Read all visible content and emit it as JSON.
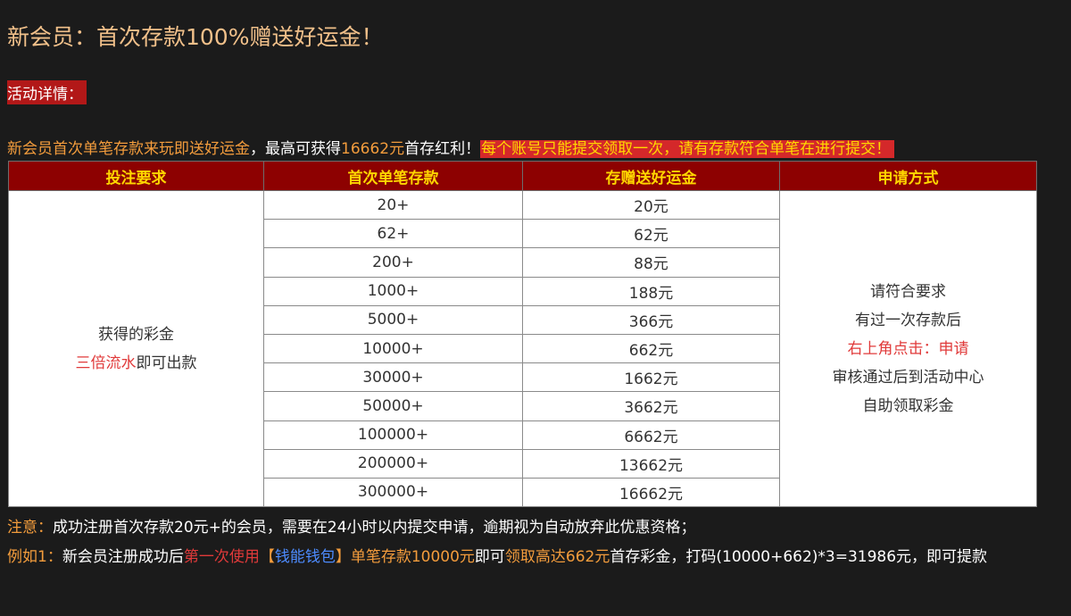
{
  "title": "新会员：首次存款100%赠送好运金！",
  "details_label": "活动详情：",
  "intro": {
    "part1": "新会员首次单笔存款来玩即送好运金",
    "part2": "，最高可获得",
    "amount": "16662元",
    "part3": "首存红利！",
    "warning": "每个账号只能提交领取一次，请有存款符合单笔在进行提交！"
  },
  "table": {
    "headers": [
      "投注要求",
      "首次单笔存款",
      "存赠送好运金",
      "申请方式"
    ],
    "requirement": {
      "line1": "获得的彩金",
      "highlight": "三倍流水",
      "line2_rest": "即可出款"
    },
    "rows": [
      {
        "deposit": "20+",
        "bonus": "20元"
      },
      {
        "deposit": "62+",
        "bonus": "62元"
      },
      {
        "deposit": "200+",
        "bonus": "88元"
      },
      {
        "deposit": "1000+",
        "bonus": "188元"
      },
      {
        "deposit": "5000+",
        "bonus": "366元"
      },
      {
        "deposit": "10000+",
        "bonus": "662元"
      },
      {
        "deposit": "30000+",
        "bonus": "1662元"
      },
      {
        "deposit": "50000+",
        "bonus": "3662元"
      },
      {
        "deposit": "100000+",
        "bonus": "6662元"
      },
      {
        "deposit": "200000+",
        "bonus": "13662元"
      },
      {
        "deposit": "300000+",
        "bonus": "16662元"
      }
    ],
    "apply": {
      "line1": "请符合要求",
      "line2": "有过一次存款后",
      "line3": "右上角点击：申请",
      "line4": "审核通过后到活动中心",
      "line5": "自助领取彩金"
    }
  },
  "note": {
    "label": "注意：",
    "text": "成功注册首次存款20元+的会员，需要在24小时以内提交申请，逾期视为自动放弃此优惠资格；"
  },
  "example": {
    "label": "例如1：",
    "t1": "新会员注册成功后",
    "t2": "第一次使用",
    "t3": "【",
    "t4": "钱能钱包",
    "t5": "】单笔存款10000元",
    "t6": "即可",
    "t7": "领取高达662元",
    "t8": "首存彩金，打码(10000+662)*3=31986元，即可提款"
  },
  "colors": {
    "title": "#f1c08a",
    "header_bg": "#8d0101",
    "header_text": "#ffd700",
    "accent_orange": "#f39c3c",
    "accent_red": "#e03a3a",
    "link_blue": "#4d8cff"
  }
}
